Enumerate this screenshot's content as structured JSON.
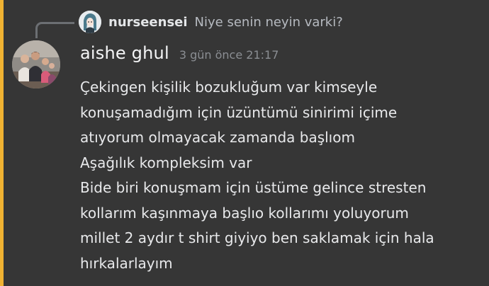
{
  "reply": {
    "username": "nurseensei",
    "text": "Niye senin neyin varki?",
    "avatar_icon": "anime-girl-avatar-icon"
  },
  "message": {
    "username": "aishe ghul",
    "timestamp": "3 gün önce 21:17",
    "avatar_icon": "group-photo-avatar",
    "lines": [
      "Çekingen kişilik bozukluğum var kimseyle",
      "konuşamadığım için üzüntümü sinirimi içime",
      "atıyorum olmayacak zamanda başlıom",
      "Aşağılık kompleksim var",
      "Bide biri konuşmam için üstüme gelince stresten",
      "kollarım kaşınmaya başlıo kollarımı yoluyorum",
      "millet 2 aydır t shirt giyiyo ben saklamak için hala",
      "hırkalarlayım"
    ]
  },
  "colors": {
    "background": "#363636",
    "highlight": "#f0b232",
    "username": "#f4f5f6",
    "timestamp": "#8b8e93",
    "text": "#e8e9eb"
  }
}
